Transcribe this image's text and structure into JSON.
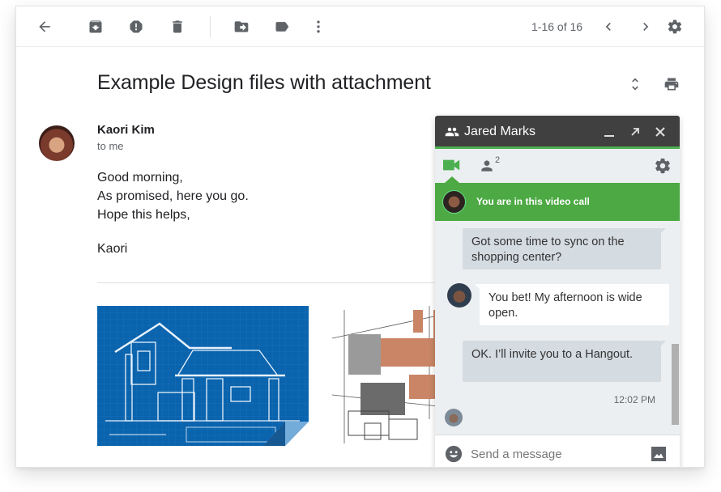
{
  "toolbar": {
    "icons": [
      "back-arrow-icon",
      "archive-icon",
      "report-spam-icon",
      "delete-icon",
      "move-to-icon",
      "label-icon",
      "more-vert-icon"
    ],
    "pager": "1-16 of 16",
    "right_icons": [
      "chevron-left-icon",
      "chevron-right-icon",
      "settings-gear-icon"
    ]
  },
  "email": {
    "subject": "Example Design files with attachment",
    "sender_name": "Kaori Kim",
    "recipient": "to me",
    "body_lines": [
      "Good morning,",
      "As promised, here you go.",
      "Hope this helps,"
    ],
    "signature": "Kaori",
    "attachments": [
      {
        "name": "blueprint-house-image"
      },
      {
        "name": "architecture-sketch-image"
      }
    ]
  },
  "chat": {
    "title": "Jared Marks",
    "participant_count": "2",
    "call_banner": "You are in this video call",
    "messages": [
      {
        "direction": "out",
        "text": "Got some time to sync on the shopping center?"
      },
      {
        "direction": "in",
        "text": "You bet! My afternoon is wide open."
      },
      {
        "direction": "out",
        "text": "OK. I’ll invite you to a Hangout."
      }
    ],
    "timestamp": "12:02 PM",
    "input_placeholder": "Send a message",
    "colors": {
      "header": "#404040",
      "accent_green": "#4ca943",
      "outgoing_bubble": "#d4dbe1",
      "incoming_bubble": "#ffffff"
    }
  }
}
